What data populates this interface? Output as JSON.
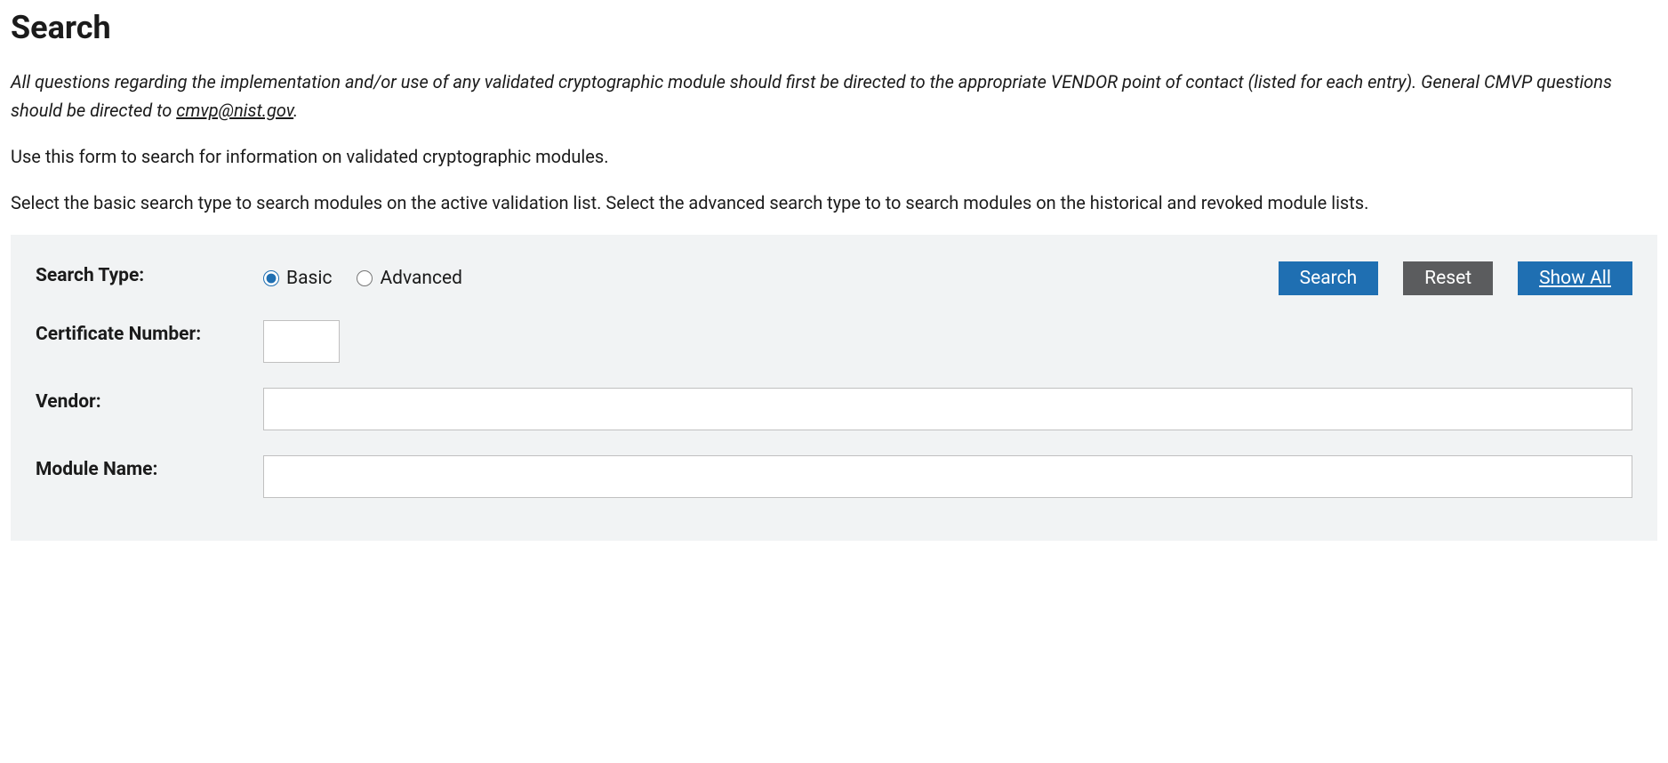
{
  "page": {
    "title": "Search",
    "intro_italic_before": "All questions regarding the implementation and/or use of any validated cryptographic module should first be directed to the appropriate VENDOR point of contact (listed for each entry). General CMVP questions should be directed to ",
    "intro_italic_link": "cmvp@nist.gov",
    "intro_italic_after": ".",
    "intro_line1": "Use this form to search for information on validated cryptographic modules.",
    "intro_line2": "Select the basic search type to search modules on the active validation list.  Select the advanced search type to to search modules on the historical and revoked module lists."
  },
  "form": {
    "labels": {
      "search_type": "Search Type:",
      "certificate_number": "Certificate Number:",
      "vendor": "Vendor:",
      "module_name": "Module Name:"
    },
    "radios": {
      "basic": "Basic",
      "advanced": "Advanced",
      "selected": "basic"
    },
    "buttons": {
      "search": "Search",
      "reset": "Reset",
      "show_all": "Show All"
    },
    "values": {
      "certificate_number": "",
      "vendor": "",
      "module_name": ""
    }
  }
}
